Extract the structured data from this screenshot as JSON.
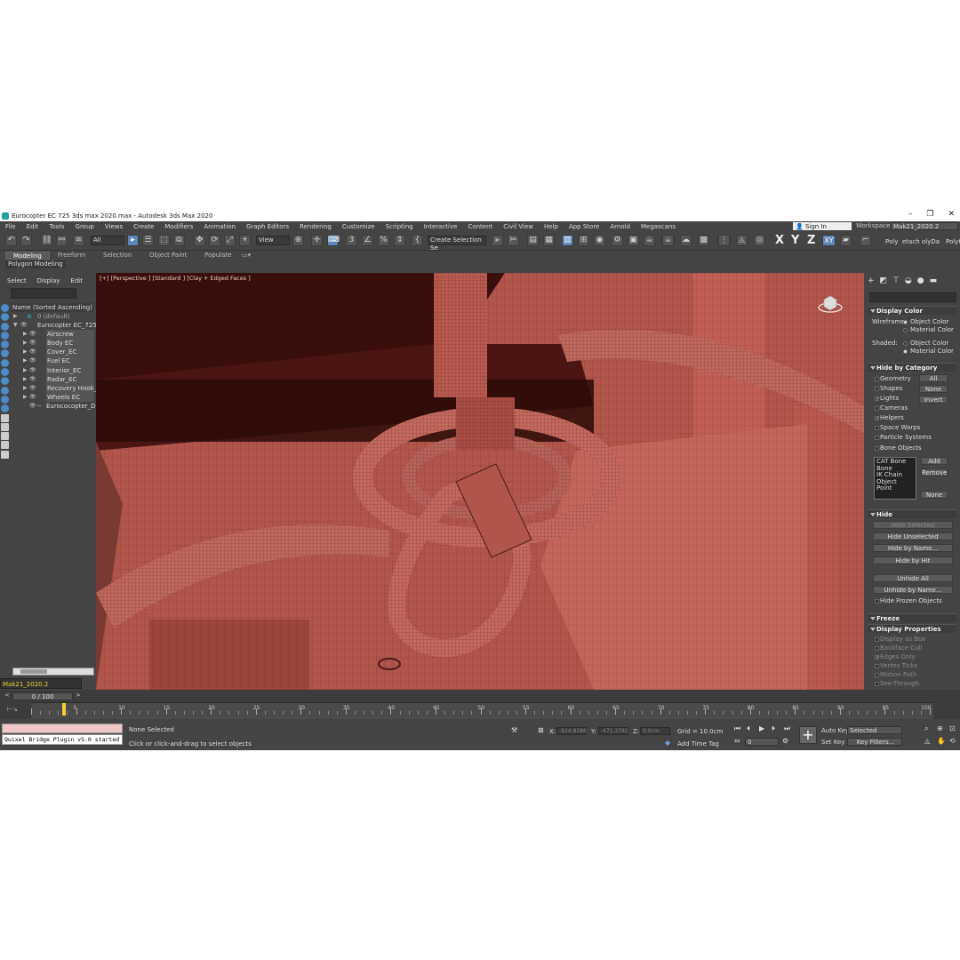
{
  "window": {
    "title": "Eurocopter EC 725 3ds max 2020.max - Autodesk 3ds Max 2020"
  },
  "menu": {
    "items": [
      "File",
      "Edit",
      "Tools",
      "Group",
      "Views",
      "Create",
      "Modifiers",
      "Animation",
      "Graph Editors",
      "Rendering",
      "Customize",
      "Scripting",
      "Interactive",
      "Content",
      "Civil View",
      "Help",
      "App Store",
      "Arnold",
      "Megascans"
    ],
    "sign_in": "Sign In",
    "workspaces_label": "Workspaces:",
    "workspace": "Mak21_2020.2"
  },
  "toolbar": {
    "filter": "All",
    "ref_coord": "View",
    "named_selection": "Create Selection Se",
    "axis_x": "X",
    "axis_y": "Y",
    "axis_z": "Z",
    "plane_xy": "XY",
    "right_tabs": [
      "Poly",
      "etach",
      "olyDa",
      "Polyt"
    ]
  },
  "ribbon": {
    "tabs": [
      "Modeling",
      "Freeform",
      "Selection",
      "Object Paint",
      "Populate"
    ],
    "panel": "Polygon Modeling"
  },
  "scene_explorer": {
    "tabs": [
      "Select",
      "Display",
      "Edit"
    ],
    "header": "Name (Sorted Ascending)",
    "items": [
      {
        "label": "0 (default)",
        "level": 0
      },
      {
        "label": "Eurocopter EC_725",
        "level": 0
      },
      {
        "label": "Airscrew",
        "level": 1
      },
      {
        "label": "Body EC",
        "level": 1
      },
      {
        "label": "Cover_EC",
        "level": 1
      },
      {
        "label": "Fuel EC",
        "level": 1
      },
      {
        "label": "Interior_EC",
        "level": 1
      },
      {
        "label": "Radar_EC",
        "level": 1
      },
      {
        "label": "Recovery Hook_EC",
        "level": 1
      },
      {
        "label": "Wheels EC",
        "level": 1
      },
      {
        "label": "Eurococopter_Dumi",
        "level": 1
      }
    ],
    "layer": "Mak21_2020.2"
  },
  "viewport": {
    "label": "[+] [Perspective ] [Standard ] [Clay + Edged Faces ]"
  },
  "command_panel": {
    "display_color": {
      "title": "Display Color",
      "wireframe_label": "Wireframe:",
      "shaded_label": "Shaded:",
      "opt_object": "Object Color",
      "opt_material": "Material Color"
    },
    "hide_by_category": {
      "title": "Hide by Category",
      "items": [
        "Geometry",
        "Shapes",
        "Lights",
        "Cameras",
        "Helpers",
        "Space Warps",
        "Particle Systems",
        "Bone Objects"
      ],
      "btn_all": "All",
      "btn_none": "None",
      "btn_invert": "Invert",
      "list": [
        "CAT Bone",
        "Bone",
        "IK Chain Object",
        "Point"
      ],
      "btn_add": "Add",
      "btn_remove": "Remove",
      "btn_none2": "None"
    },
    "hide": {
      "title": "Hide",
      "buttons": [
        "Hide Selected",
        "Hide Unselected",
        "Hide by Name...",
        "Hide by Hit",
        "Unhide All",
        "Unhide by Name..."
      ],
      "frozen": "Hide Frozen Objects"
    },
    "freeze": {
      "title": "Freeze"
    },
    "display_properties": {
      "title": "Display Properties",
      "items": [
        "Display as Box",
        "Backface Cull",
        "Edges Only",
        "Vertex Ticks",
        "Motion Path",
        "See-Through"
      ]
    }
  },
  "timeline": {
    "slider": "0 / 100",
    "ticks": [
      "5",
      "10",
      "15",
      "20",
      "25",
      "30",
      "35",
      "40",
      "45",
      "50",
      "55",
      "60",
      "65",
      "70",
      "75",
      "80",
      "85",
      "90",
      "95",
      "100"
    ]
  },
  "status": {
    "listener": "Quixel Bridge Plugin v5.0 started",
    "selection": "None Selected",
    "prompt": "Click or click-and-drag to select objects",
    "x_label": "X:",
    "x_val": "-924.8186",
    "y_label": "Y:",
    "y_val": "-471.3782",
    "z_label": "Z:",
    "z_val": "0.0cm",
    "grid": "Grid = 10.0cm",
    "add_time_tag": "Add Time Tag",
    "auto_key": "Auto Key",
    "set_key": "Set Key",
    "selected": "Selected",
    "key_filters": "Key Filters...",
    "frame": "0"
  }
}
